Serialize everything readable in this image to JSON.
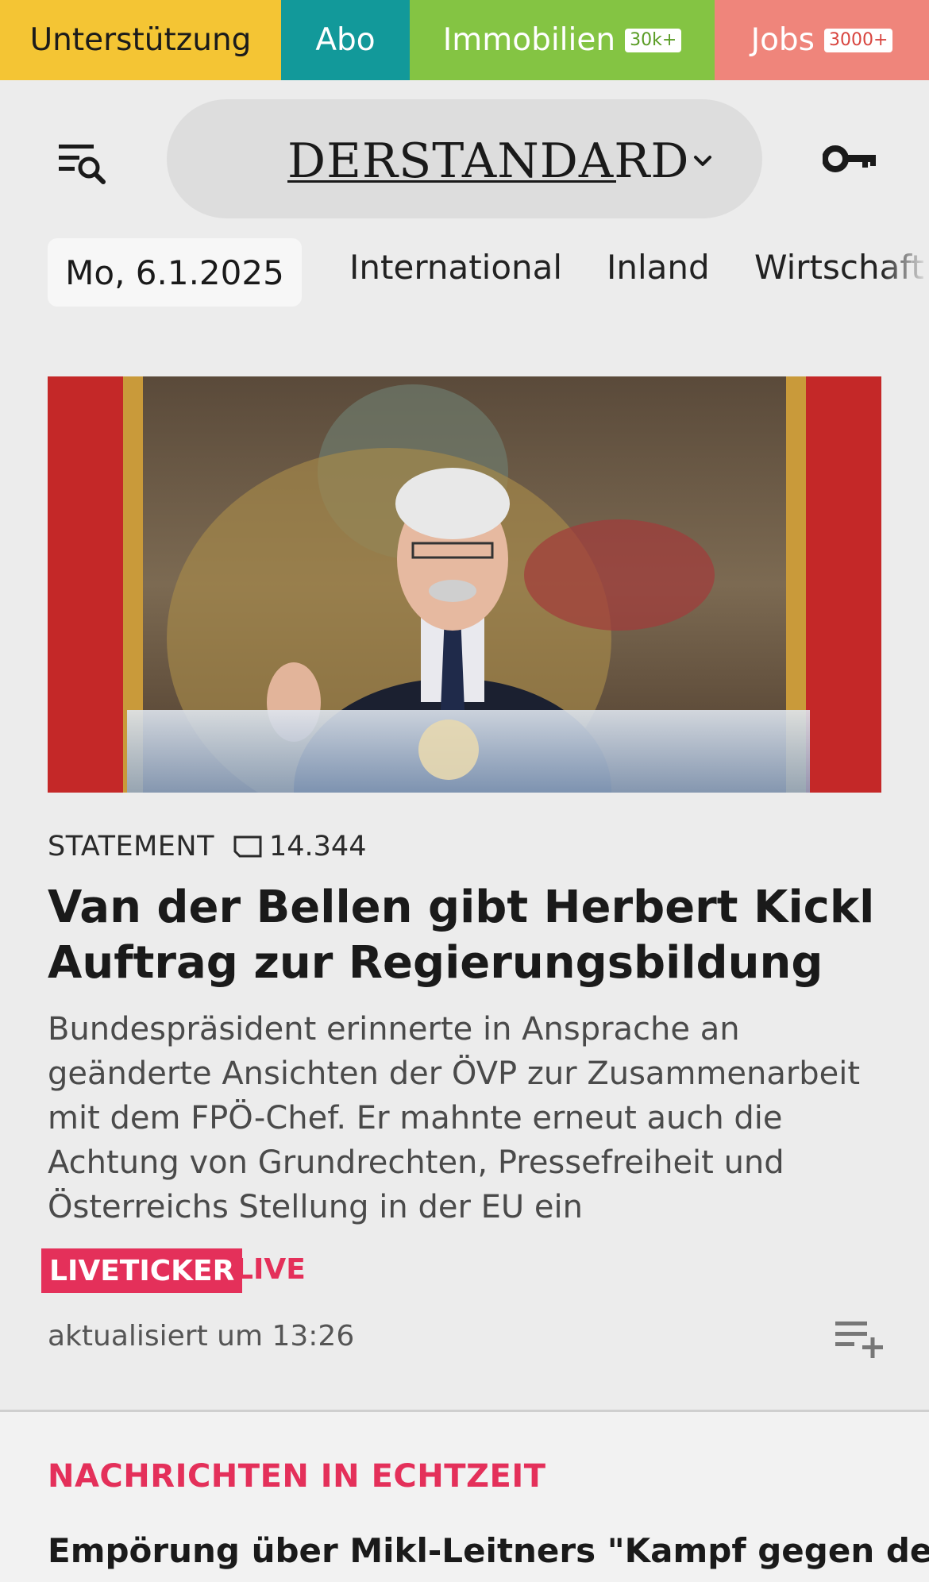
{
  "topbar": {
    "support_label": "Unterstützung",
    "abo_label": "Abo",
    "immobilien_label": "Immobilien",
    "immobilien_badge": "30k+",
    "jobs_label": "Jobs",
    "jobs_badge": "3000+"
  },
  "header": {
    "logo_prefix": "DER",
    "logo_suffix": "STANDARD",
    "icons": {
      "menu": "menu-search-icon",
      "dropdown": "chevron-down-icon",
      "login": "key-icon"
    }
  },
  "nav": {
    "date": "Mo, 6.1.2025",
    "items": [
      "International",
      "Inland",
      "Wirtschaft"
    ]
  },
  "article": {
    "kicker": "STATEMENT",
    "comment_count": "14.344",
    "headline": "Van der Bellen gibt Herbert Kickl Auftrag zur Regierungsbildung",
    "teaser": "Bundespräsident erinnerte in Ansprache an geänderte Ansichten der ÖVP zur Zusammenarbeit mit dem FPÖ-Chef. Er mahnte erneut auch die Achtung von Grundrechten, Pressefreiheit und Österreichs Stellung in der EU ein",
    "live_badge": "LIVETICKER",
    "live_label": "LIVE",
    "updated": "aktualisiert um 13:26"
  },
  "section2": {
    "title": "NACHRICHTEN IN ECHTZEIT",
    "first_headline": "Empörung über Mikl-Leitners \"Kampf gegen den"
  },
  "colors": {
    "support": "#f4c534",
    "abo": "#12999a",
    "immobilien": "#84c443",
    "jobs": "#ef857b",
    "accent_red": "#e4305a",
    "background": "#ececec"
  }
}
